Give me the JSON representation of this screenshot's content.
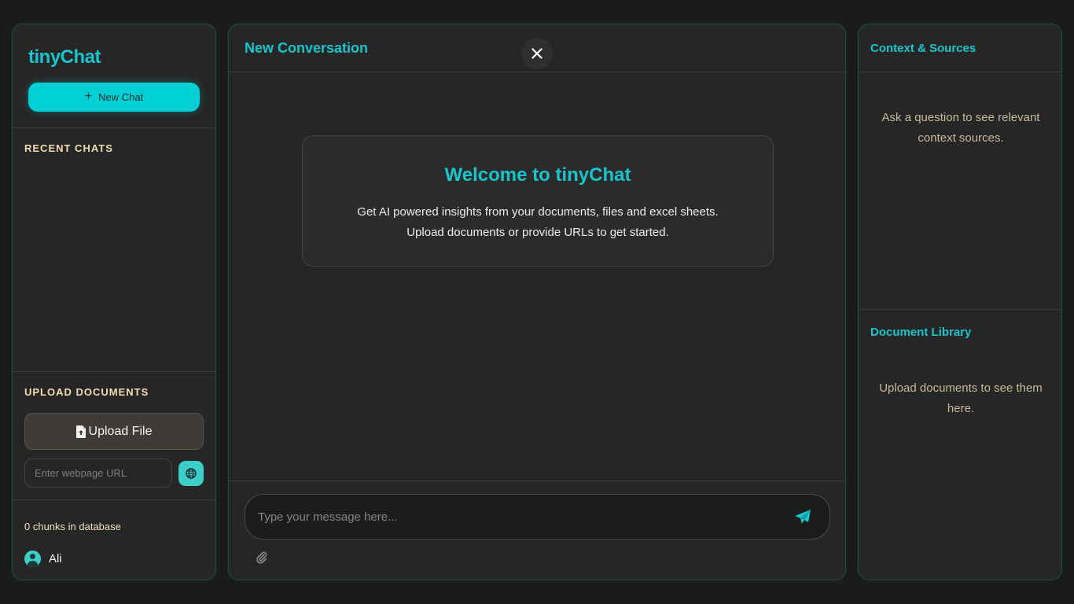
{
  "sidebar": {
    "brand": "tinyChat",
    "new_chat_label": "New Chat",
    "recent_chats_title": "RECENT CHATS",
    "recent_chats": [],
    "upload_title": "UPLOAD DOCUMENTS",
    "upload_file_label": "Upload File",
    "url_placeholder": "Enter webpage URL",
    "url_value": "",
    "chunks_status": "0 chunks in database",
    "user_name": "Ali"
  },
  "main": {
    "conversation_title": "New Conversation",
    "welcome_title": "Welcome to tinyChat",
    "welcome_line1": "Get AI powered insights from your documents, files and excel sheets.",
    "welcome_line2": "Upload documents or provide URLs to get started.",
    "message_placeholder": "Type your message here...",
    "message_value": ""
  },
  "right_panel": {
    "context_title": "Context & Sources",
    "context_empty": "Ask a question to see relevant context sources.",
    "library_title": "Document Library",
    "library_empty": "Upload documents to see them here."
  },
  "icons": {
    "new_chat": "plus-icon",
    "upload": "file-upload-icon",
    "url_submit": "globe-icon",
    "user": "user-circle-icon",
    "close": "close-icon",
    "send": "paper-plane-icon",
    "attach": "paperclip-icon"
  },
  "colors": {
    "accent": "#17c5cc",
    "button_accent": "#00cfd4",
    "section_title": "#f3dcb1",
    "background": "#1b1b1b",
    "panel": "#262626"
  }
}
